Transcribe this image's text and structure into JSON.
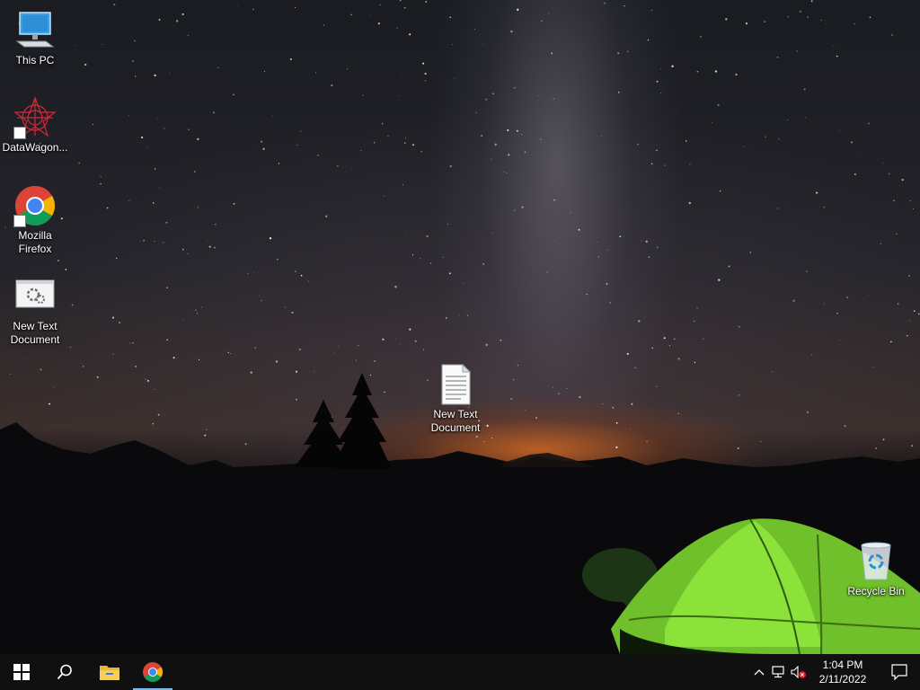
{
  "desktop": {
    "icons": [
      {
        "id": "this-pc",
        "label": "This PC",
        "icon": "computer-icon"
      },
      {
        "id": "datawagon",
        "label": "DataWagon...",
        "icon": "datawagon-icon"
      },
      {
        "id": "mozilla-firefox",
        "label": "Mozilla Firefox",
        "icon": "chrome-icon"
      },
      {
        "id": "new-text-document-1",
        "label": "New Text Document",
        "icon": "settings-document-icon"
      },
      {
        "id": "new-text-document-2",
        "label": "New Text Document",
        "icon": "text-document-icon"
      },
      {
        "id": "recycle-bin",
        "label": "Recycle Bin",
        "icon": "recycle-bin-icon"
      }
    ]
  },
  "taskbar": {
    "start_icon": "windows-start-icon",
    "search_icon": "search-icon",
    "pinned": [
      {
        "name": "File Explorer",
        "icon": "folder-icon",
        "active": false
      },
      {
        "name": "Google Chrome",
        "icon": "chrome-icon",
        "active": true
      }
    ],
    "tray": {
      "icons": [
        "chevron-up-icon",
        "network-icon",
        "volume-muted-icon"
      ],
      "time": "1:04 PM",
      "date": "2/11/2022",
      "notification_icon": "action-center-icon"
    }
  },
  "colors": {
    "taskbar_bg": "#101010",
    "active_indicator": "#76b9ed",
    "tent_green": "#8be33a"
  }
}
